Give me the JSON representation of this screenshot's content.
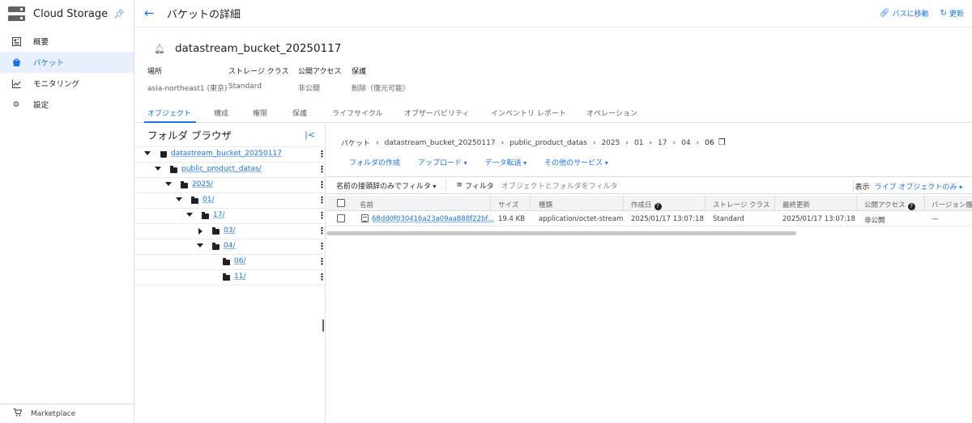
{
  "sidebar": {
    "title": "Cloud Storage",
    "items": [
      {
        "label": "概要",
        "icon": "dashboard-icon"
      },
      {
        "label": "バケット",
        "icon": "bucket-icon",
        "active": true
      },
      {
        "label": "モニタリング",
        "icon": "chart-icon"
      },
      {
        "label": "設定",
        "icon": "gear-icon"
      }
    ],
    "footer": "Marketplace"
  },
  "topbar": {
    "title": "バケットの詳細",
    "path_link": "パスに移動",
    "refresh": "更新"
  },
  "bucket": {
    "name": "datastream_bucket_20250117",
    "meta": [
      {
        "label": "場所",
        "value": "asia-northeast1 (東京)"
      },
      {
        "label": "ストレージ クラス",
        "value": "Standard"
      },
      {
        "label": "公開アクセス",
        "value": "非公開"
      },
      {
        "label": "保護",
        "value": "削除（復元可能）"
      }
    ]
  },
  "tabs": [
    "オブジェクト",
    "構成",
    "権限",
    "保護",
    "ライフサイクル",
    "オブザーバビリティ",
    "インベントリ レポート",
    "オペレーション"
  ],
  "folder_browser": {
    "title": "フォルダ ブラウザ",
    "tree": [
      {
        "label": "datastream_bucket_20250117",
        "depth": 0,
        "type": "bucket",
        "expanded": true
      },
      {
        "label": "public_product_datas/",
        "depth": 1,
        "type": "folder",
        "expanded": true
      },
      {
        "label": "2025/",
        "depth": 2,
        "type": "folder",
        "expanded": true
      },
      {
        "label": "01/",
        "depth": 3,
        "type": "folder",
        "expanded": true
      },
      {
        "label": "17/",
        "depth": 4,
        "type": "folder",
        "expanded": true
      },
      {
        "label": "03/",
        "depth": 5,
        "type": "folder",
        "expanded": false
      },
      {
        "label": "04/",
        "depth": 5,
        "type": "folder",
        "expanded": true
      },
      {
        "label": "06/",
        "depth": 6,
        "type": "folder",
        "leaf": true
      },
      {
        "label": "11/",
        "depth": 6,
        "type": "folder",
        "leaf": true
      }
    ]
  },
  "breadcrumb": [
    "バケット",
    "datastream_bucket_20250117",
    "public_product_datas",
    "2025",
    "01",
    "17",
    "04",
    "06"
  ],
  "actions": [
    "フォルダの作成",
    "アップロード",
    "データ転送",
    "その他のサービス"
  ],
  "filter": {
    "mode": "名前の接頭辞のみでフィルタ",
    "label": "フィルタ",
    "placeholder": "オブジェクトとフォルダをフィルタ",
    "view_label": "表示",
    "view_value": "ライブ オブジェクトのみ"
  },
  "table": {
    "headers": [
      "名前",
      "サイズ",
      "種類",
      "作成日",
      "ストレージ クラス",
      "最終更新",
      "公開アクセス",
      "バージョン履歴"
    ],
    "rows": [
      {
        "name": "68dd0f030416a23a09aa888f22bf...",
        "size": "19.4 KB",
        "type": "application/octet-stream",
        "created": "2025/01/17 13:07:18",
        "storage_class": "Standard",
        "updated": "2025/01/17 13:07:18",
        "public": "非公開",
        "version": "—"
      }
    ]
  }
}
